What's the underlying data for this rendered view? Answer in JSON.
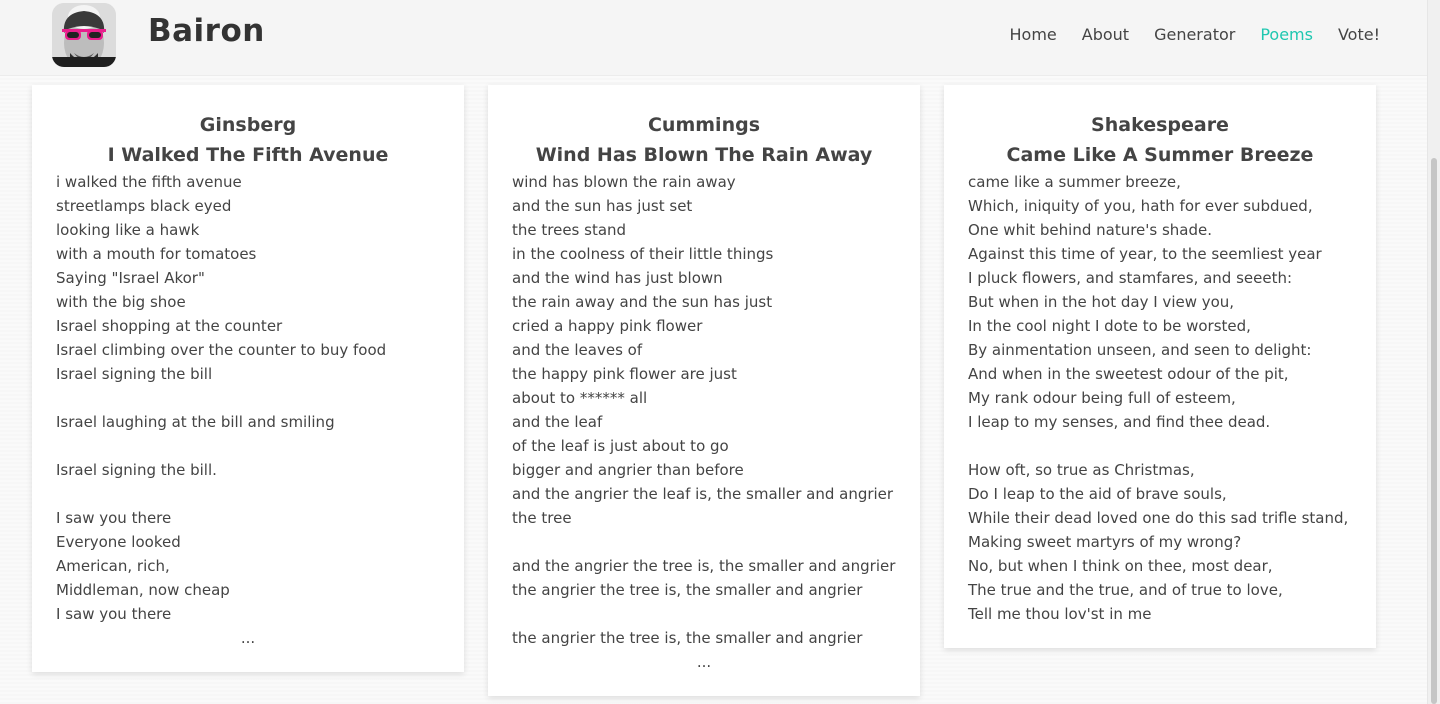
{
  "brand": {
    "name": "Bairon",
    "logo_icon": "shakespeare-sunglasses-avatar"
  },
  "nav": {
    "items": [
      {
        "label": "Home"
      },
      {
        "label": "About"
      },
      {
        "label": "Generator"
      },
      {
        "label": "Poems",
        "active": true
      },
      {
        "label": "Vote!"
      }
    ],
    "active_color": "#1fc7b0"
  },
  "poems": [
    {
      "author": "Ginsberg",
      "title": "I Walked The Fifth Avenue",
      "lines": [
        "i walked the fifth avenue",
        "streetlamps black eyed",
        "looking like a hawk",
        "with a mouth for tomatoes",
        "Saying \"Israel Akor\"",
        "with the big shoe",
        "Israel shopping at the counter",
        "Israel climbing over the counter to buy food",
        "Israel signing the bill",
        "",
        "Israel laughing at the bill and smiling",
        "",
        "Israel signing the bill.",
        "",
        "I saw you there",
        "Everyone looked",
        "American, rich,",
        "Middleman, now cheap",
        "I saw you there"
      ],
      "more": "..."
    },
    {
      "author": "Cummings",
      "title": "Wind Has Blown The Rain Away",
      "lines": [
        "wind has blown the rain away",
        "and the sun has just set",
        "the trees stand",
        "in the coolness of their little things",
        "and the wind has just blown",
        "the rain away and the sun has just",
        "cried a happy pink flower",
        "and the leaves of",
        "the happy pink flower are just",
        "about to ****** all",
        "and the leaf",
        "of the leaf is just about to go",
        "bigger and angrier than before",
        "and the angrier the leaf is, the smaller and angrier",
        "the tree",
        "",
        "and the angrier the tree is, the smaller and angrier",
        "the angrier the tree is, the smaller and angrier",
        "",
        "the angrier the tree is, the smaller and angrier"
      ],
      "more": "..."
    },
    {
      "author": "Shakespeare",
      "title": "Came Like A Summer Breeze",
      "lines": [
        "came like a summer breeze,",
        "Which, iniquity of you, hath for ever subdued,",
        "One whit behind nature's shade.",
        "Against this time of year, to the seemliest year",
        "I pluck flowers, and stamfares, and seeeth:",
        "But when in the hot day I view you,",
        "In the cool night I dote to be worsted,",
        "By ainmentation unseen, and seen to delight:",
        "And when in the sweetest odour of the pit,",
        "My rank odour being full of esteem,",
        "I leap to my senses, and find thee dead.",
        "",
        "How oft, so true as Christmas,",
        "Do I leap to the aid of brave souls,",
        "While their dead loved one do this sad trifle stand,",
        "Making sweet martyrs of my wrong?",
        "No, but when I think on thee, most dear,",
        "The true and the true, and of true to love,",
        "Tell me thou lov'st in me"
      ],
      "more": ""
    }
  ]
}
